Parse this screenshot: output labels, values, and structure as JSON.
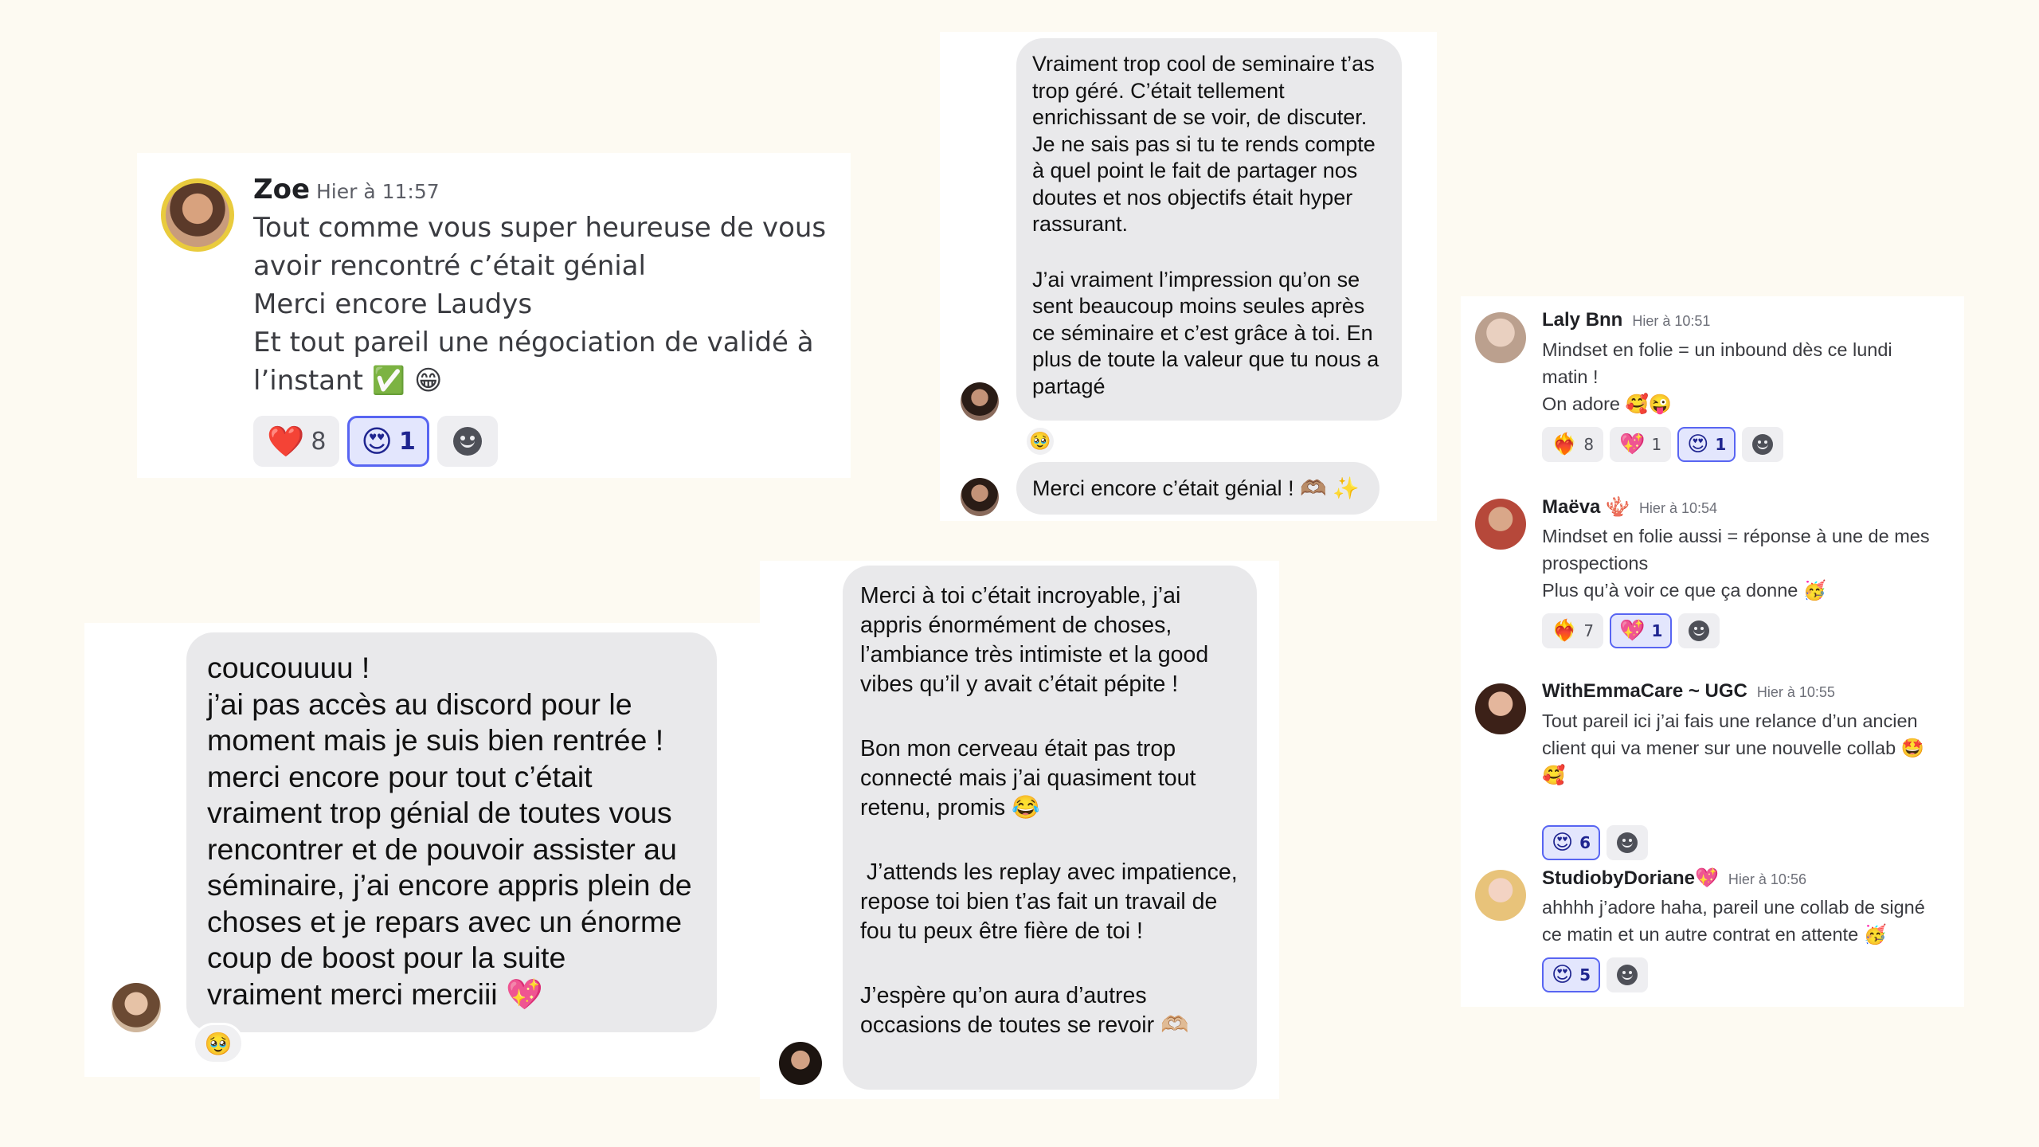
{
  "zoe_card": {
    "username": "Zoe",
    "timestamp": "Hier à 11:57",
    "lines": [
      "Tout comme vous super heureuse de vous",
      "avoir rencontré c’était génial",
      "Merci encore Laudys",
      "Et tout pareil une négociation de validé à",
      "l’instant ✅ 😁"
    ],
    "reactions": [
      {
        "emoji": "❤️",
        "count": "8"
      },
      {
        "emoji": "😍",
        "count": "1"
      }
    ]
  },
  "imessage_top": {
    "bubble1_paragraphs": [
      "Vraiment trop cool de seminaire t’as trop géré. C’était tellement enrichissant de se voir, de discuter. Je ne sais pas si tu te rends compte à quel point le fait de partager nos doutes et nos objectifs était hyper rassurant.",
      "J’ai vraiment l’impression qu’on se sent beaucoup moins seules après ce séminaire et c’est grâce à toi. En plus de toute la valeur que tu nous a partagé"
    ],
    "tapback": "🥹",
    "bubble2": "Merci encore c’était génial ! 🫶🏽 ✨"
  },
  "community": {
    "messages": [
      {
        "name": "Laly Bnn",
        "time": "Hier à 10:51",
        "text_lines": [
          "Mindset en folie = un inbound dès ce lundi",
          "matin !",
          "On adore 🥰😜"
        ],
        "reactions": [
          {
            "emoji": "❤️‍🔥",
            "count": "8"
          },
          {
            "emoji": "💖",
            "count": "1"
          },
          {
            "emoji": "😍",
            "count": "1"
          }
        ]
      },
      {
        "name": "Maëva 🪸",
        "time": "Hier à 10:54",
        "text_lines": [
          "Mindset en folie aussi = réponse à une de mes",
          "prospections",
          "Plus qu’à voir ce que ça donne 🥳"
        ],
        "reactions": [
          {
            "emoji": "❤️‍🔥",
            "count": "7"
          },
          {
            "emoji": "💖",
            "count": "1"
          }
        ]
      },
      {
        "name": "WithEmmaCare ~ UGC",
        "time": "Hier à 10:55",
        "text_lines": [
          "Tout pareil ici j’ai fais une relance d’un ancien",
          "client qui va mener sur une nouvelle collab 🤩",
          "🥰"
        ],
        "reactions": [
          {
            "emoji": "😍",
            "count": "6"
          }
        ]
      },
      {
        "name": "StudiobyDoriane💖",
        "time": "Hier à 10:56",
        "text_lines": [
          "ahhhh j’adore haha, pareil une collab de signé",
          "ce matin et un autre contrat en attente 🥳"
        ],
        "reactions": [
          {
            "emoji": "😍",
            "count": "5"
          }
        ]
      }
    ]
  },
  "imessage_left": {
    "lines": [
      "coucouuuu !",
      "j’ai pas accès au discord pour le",
      "moment mais je suis bien rentrée !",
      "merci encore pour tout c’était",
      "vraiment trop génial de toutes vous",
      "rencontrer et de pouvoir assister au",
      "séminaire, j’ai encore appris plein de",
      "choses et je repars avec un énorme",
      "coup de boost pour la suite",
      "vraiment merci merciii 💖"
    ],
    "tapback": "🥹"
  },
  "imessage_mid": {
    "paragraphs": [
      "Merci à toi c’était incroyable, j’ai appris énormément de choses, l’ambiance très intimiste et la good vibes qu’il y avait c’était pépite !",
      "Bon mon cerveau était pas trop connecté mais j’ai quasiment tout retenu, promis 😂",
      " J’attends les replay avec impatience, repose toi bien t’as fait un travail de fou tu peux être fière de toi !",
      "J’espère qu’on aura d’autres occasions de toutes se revoir 🫶🏼"
    ]
  }
}
